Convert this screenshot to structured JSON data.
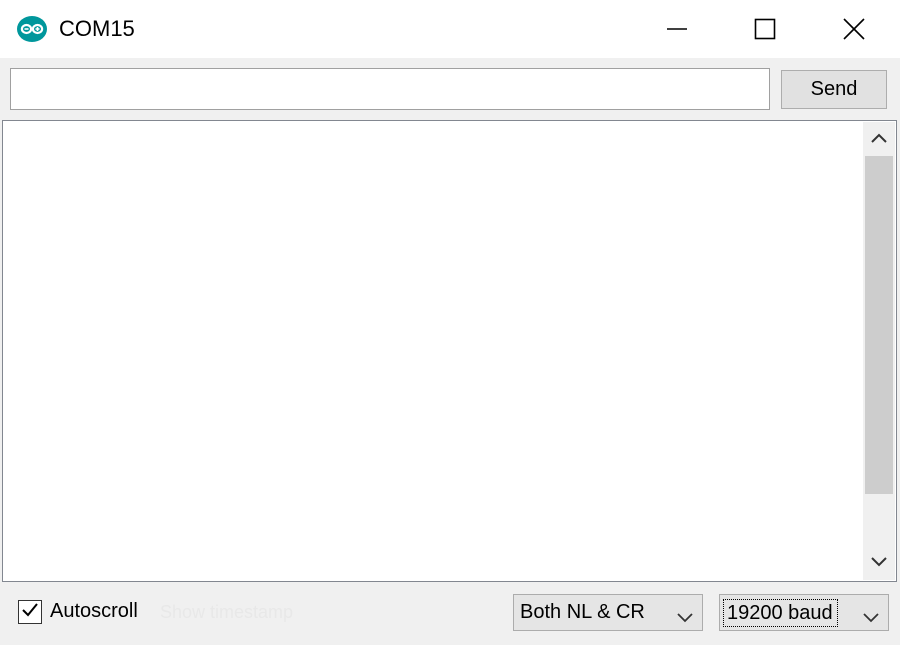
{
  "window": {
    "title": "COM15",
    "app_icon": "arduino-infinity-icon",
    "controls": [
      "minimize-icon",
      "maximize-icon",
      "close-icon"
    ]
  },
  "input_bar": {
    "value": "",
    "placeholder": "",
    "send_label": "Send"
  },
  "output": {
    "text": ""
  },
  "status": {
    "autoscroll_label": "Autoscroll",
    "autoscroll_checked": true,
    "hint_text": "Show timestamp"
  },
  "line_ending": {
    "selected": "Both NL & CR",
    "icon": "chevron-down-icon"
  },
  "baud": {
    "selected": "19200 baud",
    "icon": "chevron-down-icon"
  },
  "colors": {
    "titlebar_bg": "#ffffff",
    "window_bg": "#f0f0f0",
    "arduino_teal": "#00979c"
  }
}
